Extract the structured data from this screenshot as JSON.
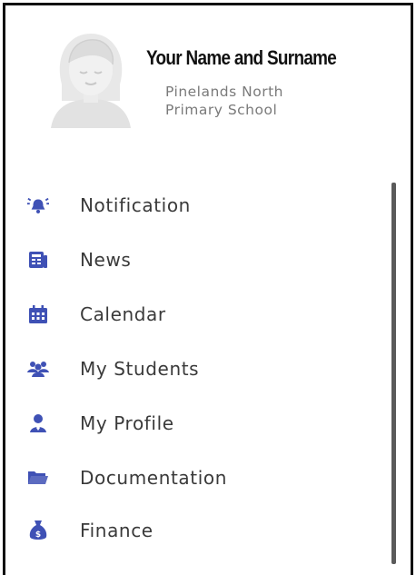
{
  "profile": {
    "name": "Your Name and Surname",
    "school_line1": "Pinelands North",
    "school_line2": "Primary School"
  },
  "menu": {
    "items": [
      {
        "label": "Notification",
        "icon": "bell-icon"
      },
      {
        "label": "News",
        "icon": "newspaper-icon"
      },
      {
        "label": "Calendar",
        "icon": "calendar-icon"
      },
      {
        "label": "My Students",
        "icon": "users-icon"
      },
      {
        "label": "My Profile",
        "icon": "user-icon"
      },
      {
        "label": "Documentation",
        "icon": "folder-icon"
      },
      {
        "label": "Finance",
        "icon": "money-bag-icon"
      }
    ]
  },
  "colors": {
    "icon": "#3f51b5",
    "label": "#3a3a3a",
    "subtext": "#7a7a7a",
    "scrollbar": "#5a5a5a"
  }
}
